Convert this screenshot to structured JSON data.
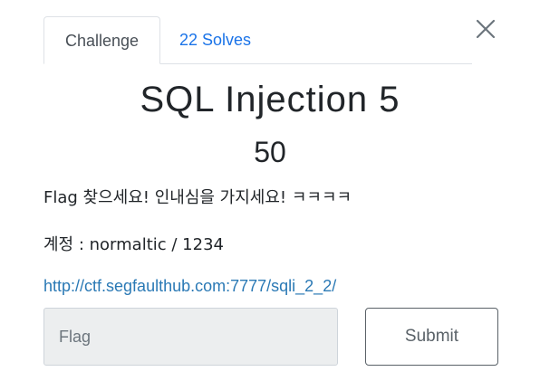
{
  "tabs": [
    {
      "label": "Challenge"
    },
    {
      "label": "22 Solves"
    }
  ],
  "close_icon": "close-icon",
  "challenge": {
    "title": "SQL Injection 5",
    "value": "50",
    "description_line1": "Flag 찾으세요! 인내심을 가지세요! ㅋㅋㅋㅋ",
    "description_line2": "계정 : normaltic / 1234",
    "link": "http://ctf.segfaulthub.com:7777/sqli_2_2/"
  },
  "form": {
    "flag_placeholder": "Flag",
    "submit_label": "Submit"
  },
  "colors": {
    "link": "#2a79b5",
    "tab_link": "#1a73e8"
  }
}
